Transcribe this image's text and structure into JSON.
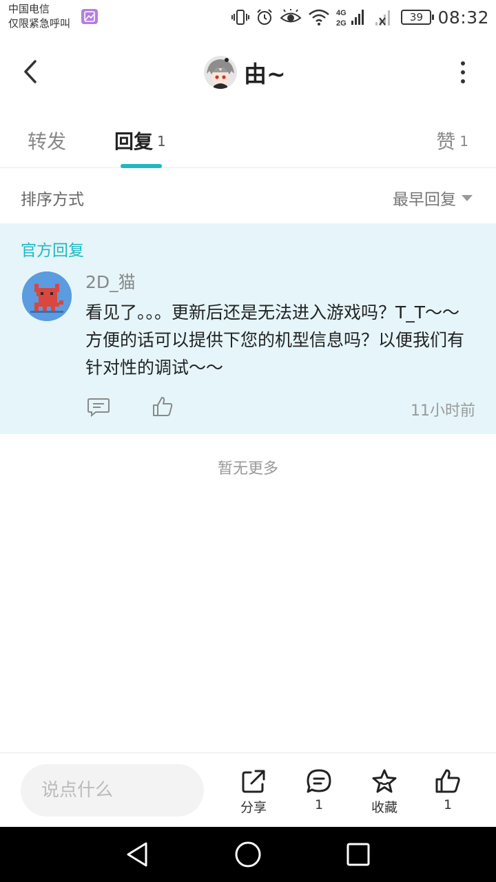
{
  "status_bar": {
    "carrier_line1": "中国电信",
    "carrier_line2": "仅限紧急呼叫",
    "network_top": "4G",
    "network_bottom": "2G",
    "battery": "39",
    "time": "08:32"
  },
  "header": {
    "title": "由~"
  },
  "tabs": {
    "forward_label": "转发",
    "reply_label": "回复",
    "reply_count": "1",
    "like_label": "赞",
    "like_count": "1"
  },
  "sort": {
    "label": "排序方式",
    "value": "最早回复"
  },
  "official_reply": {
    "section_label": "官方回复",
    "author": "2D_猫",
    "text": "看见了。。。更新后还是无法进入游戏吗？T_T～～方便的话可以提供下您的机型信息吗？以便我们有针对性的调试～～",
    "time": "11小时前"
  },
  "list_end": "暂无更多",
  "bottom_bar": {
    "input_placeholder": "说点什么",
    "share_label": "分享",
    "comment_count": "1",
    "favorite_label": "收藏",
    "like_count": "1"
  },
  "colors": {
    "accent": "#1fb8c3",
    "official_bg": "#e5f5f9"
  }
}
